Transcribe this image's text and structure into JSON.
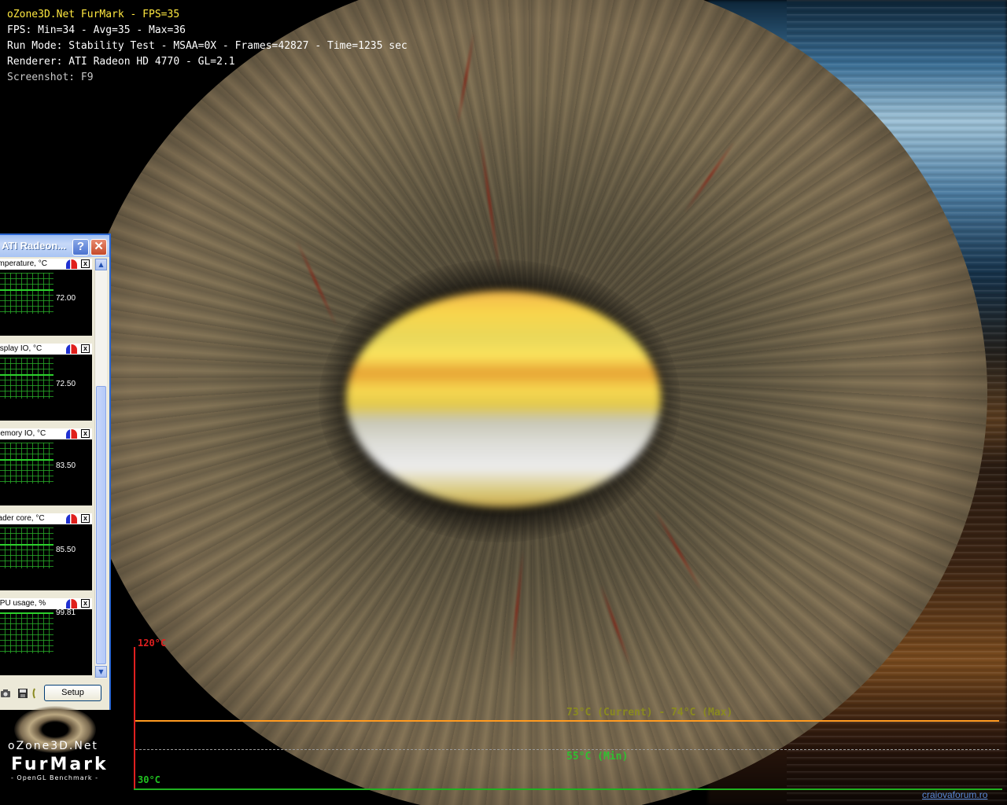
{
  "osd": {
    "title": "oZone3D.Net FurMark - FPS=35",
    "fps_line": "FPS: Min=34 - Avg=35 - Max=36",
    "run_mode_line": "Run Mode: Stability Test - MSAA=0X - Frames=42827 - Time=1235 sec",
    "renderer_line": "Renderer: ATI Radeon HD 4770 - GL=2.1",
    "screenshot_hint": "Screenshot: F9"
  },
  "sensor_window": {
    "title": "ATI Radeon...",
    "help_label": "?",
    "close_label": "✕",
    "panels": [
      {
        "label": "emperature, °C",
        "value": "72.00",
        "level": 0.6
      },
      {
        "label": "display IO, °C",
        "value": "72.50",
        "level": 0.6
      },
      {
        "label": "memory IO, °C",
        "value": "83.50",
        "level": 0.6
      },
      {
        "label": "nader core, °C",
        "value": "85.50",
        "level": 0.6
      },
      {
        "label": "GPU usage, %",
        "value": "99.81",
        "level": 0.998
      }
    ],
    "setup_label": "Setup",
    "icons": [
      "camera-icon",
      "save-icon",
      "tool-icon"
    ]
  },
  "logo": {
    "site": "oZone3D.Net",
    "product": "FurMark",
    "subtitle": "- OpenGL Benchmark -"
  },
  "temperature_graph": {
    "max_label": "120°C",
    "min_label": "30°C",
    "current_text": "73°C (Current) - 74°C (Max)",
    "min_text": "55°C (Min)",
    "line_color": "#ff9a20"
  },
  "watermark": "craiovaforum.ro"
}
